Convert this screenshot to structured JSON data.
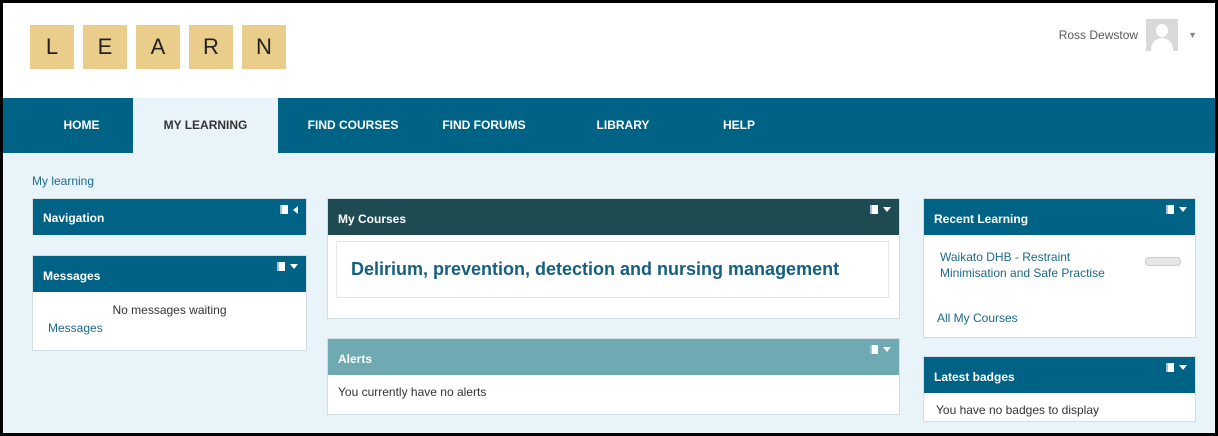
{
  "logo": {
    "letters": [
      "L",
      "E",
      "A",
      "R",
      "N"
    ]
  },
  "user": {
    "name": "Ross Dewstow"
  },
  "nav": {
    "items": [
      {
        "label": "HOME"
      },
      {
        "label": "MY LEARNING"
      },
      {
        "label": "FIND COURSES"
      },
      {
        "label": "FIND FORUMS"
      },
      {
        "label": "LIBRARY"
      },
      {
        "label": "HELP"
      }
    ],
    "active": "MY LEARNING"
  },
  "breadcrumb": "My learning",
  "navigation_block": {
    "title": "Navigation"
  },
  "messages_block": {
    "title": "Messages",
    "empty_text": "No messages waiting",
    "link": "Messages"
  },
  "my_courses": {
    "title": "My Courses",
    "course": "Delirium, prevention, detection and nursing management"
  },
  "alerts": {
    "title": "Alerts",
    "empty_text": "You currently have no alerts"
  },
  "recent_learning": {
    "title": "Recent Learning",
    "item_line1": "Waikato DHB - Restraint",
    "item_line2": "Minimisation and Safe Practise",
    "link": "All My Courses"
  },
  "latest_badges": {
    "title": "Latest badges",
    "empty_text": "You have no badges to display"
  },
  "colors": {
    "nav_bg": "#006284",
    "page_bg": "#e9f4fa",
    "tile": "#eacd8a",
    "link": "#1b6a8a"
  }
}
